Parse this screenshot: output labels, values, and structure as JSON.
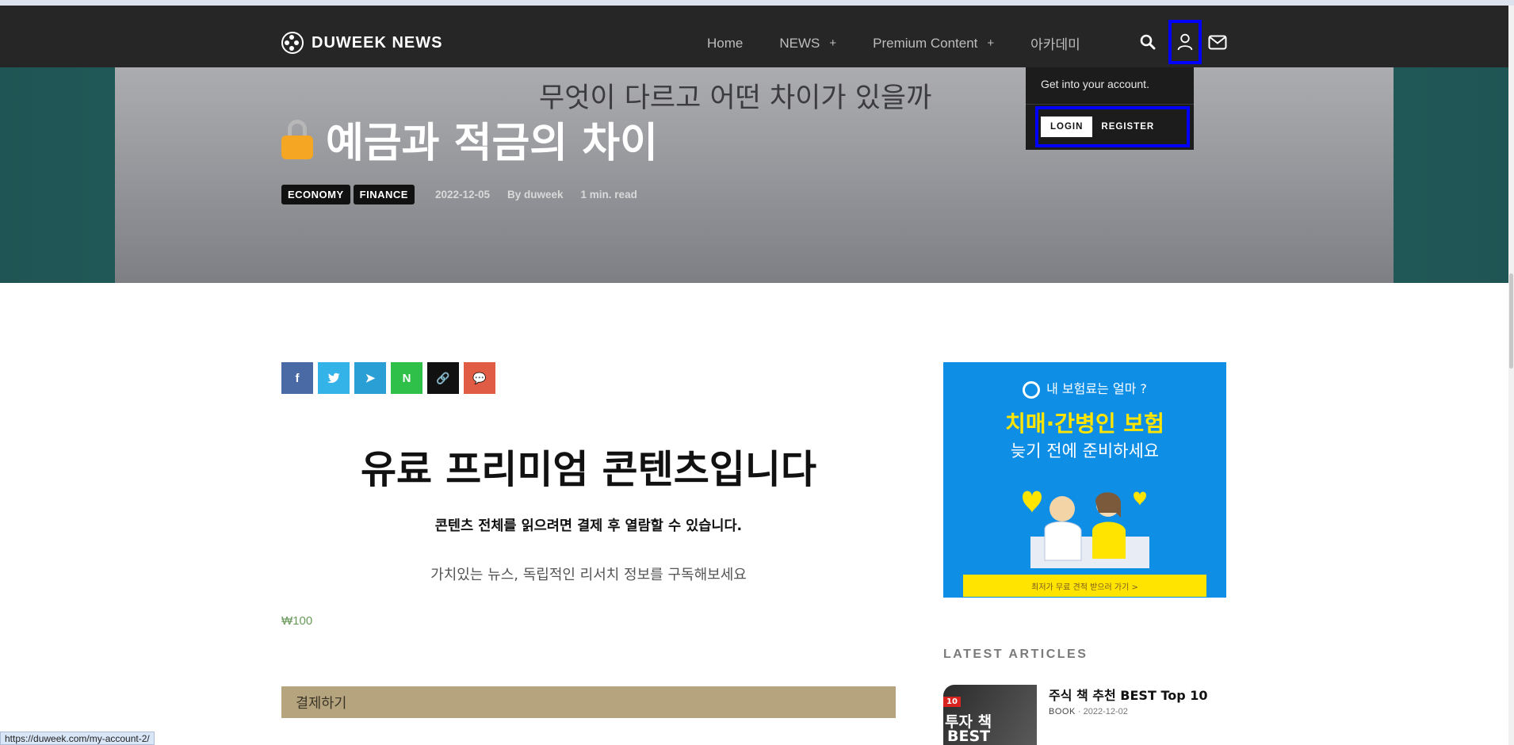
{
  "brand": {
    "name": "DUWEEK NEWS"
  },
  "nav": {
    "items": [
      {
        "label": "Home",
        "plus": ""
      },
      {
        "label": "NEWS",
        "plus": "+"
      },
      {
        "label": "Premium Content",
        "plus": "+"
      },
      {
        "label": "아카데미",
        "plus": ""
      }
    ]
  },
  "account_dropdown": {
    "title": "Get into your account.",
    "login_label": "LOGIN",
    "register_label": "REGISTER"
  },
  "hero": {
    "subtitle": "무엇이 다르고 어떤 차이가 있을까",
    "title": "예금과 적금의 차이",
    "tags": [
      "ECONOMY",
      "FINANCE"
    ],
    "date": "2022-12-05",
    "author": "By duweek",
    "read_time": "1 min. read"
  },
  "share": {
    "facebook": "f",
    "twitter": "t",
    "telegram": "➤",
    "naver": "N",
    "link": "🔗",
    "kakao": "💬"
  },
  "premium": {
    "title": "유료 프리미엄 콘텐츠입니다",
    "description": "콘텐츠 전체를 읽으려면 결제 후 열람할 수 있습니다.",
    "note": "가치있는 뉴스, 독립적인 리서치 정보를 구독해보세요",
    "price": "₩100",
    "pay_label": "결제하기"
  },
  "ad": {
    "top": "내 보험료는 얼마 ?",
    "headline": "치매·간병인 보험",
    "subline": "늦기 전에 준비하세요",
    "cta": "최저가 무료 견적 받으러 가기 >"
  },
  "sidebar": {
    "latest_label": "LATEST ARTICLES",
    "article": {
      "title": "주식 책 추천 BEST Top 10",
      "category": "BOOK",
      "date": "2022-12-02",
      "thumb_badge": "10",
      "thumb_line1": "투자 책",
      "thumb_line2": "BEST"
    }
  },
  "status_bar": {
    "url": "https://duweek.com/my-account-2/"
  },
  "colors": {
    "topbar": "#262626",
    "facebook": "#4a6aa5",
    "twitter": "#33b3e8",
    "telegram": "#2a9fd6",
    "naver": "#2fc04a",
    "link": "#111111",
    "kakao": "#e15c44",
    "pay_button": "#b5a47d",
    "ad_background": "#0f8ee6",
    "highlight_box": "#0000ff"
  }
}
